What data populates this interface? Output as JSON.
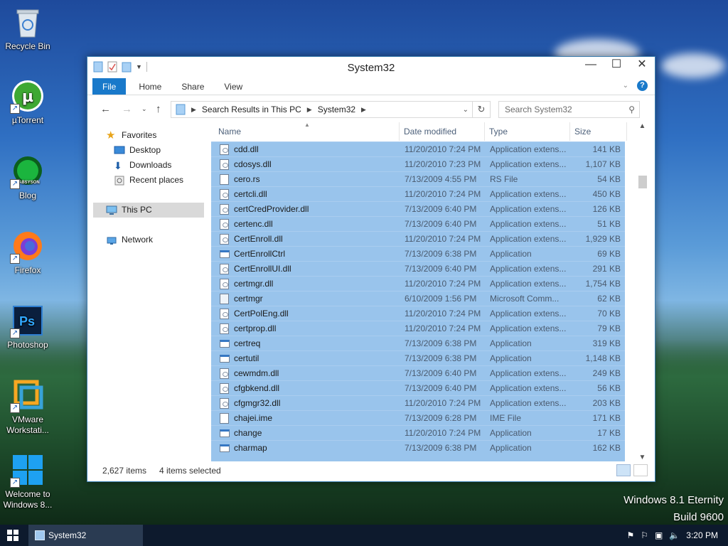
{
  "desktop": {
    "icons": [
      {
        "label": "Recycle Bin"
      },
      {
        "label": "µTorrent"
      },
      {
        "label": "Blog"
      },
      {
        "label": "Firefox"
      },
      {
        "label": "Photoshop"
      },
      {
        "label": "VMware Workstati..."
      },
      {
        "label": "Welcome to Windows 8..."
      }
    ],
    "blog_logo_text": "LABSYSON",
    "watermark_line1": "Windows 8.1 Eternity",
    "watermark_line2": "Build 9600"
  },
  "window": {
    "title": "System32",
    "tabs": {
      "file": "File",
      "home": "Home",
      "share": "Share",
      "view": "View"
    },
    "address": {
      "crumb1": "Search Results in This PC",
      "crumb2": "System32"
    },
    "search_placeholder": "Search System32",
    "nav": {
      "favorites": "Favorites",
      "desktop": "Desktop",
      "downloads": "Downloads",
      "recent": "Recent places",
      "thispc": "This PC",
      "network": "Network"
    },
    "columns": {
      "name": "Name",
      "date": "Date modified",
      "type": "Type",
      "size": "Size"
    },
    "files": [
      {
        "name": "cdd.dll",
        "date": "11/20/2010 7:24 PM",
        "type": "Application extens...",
        "size": "141 KB",
        "icon": "dll"
      },
      {
        "name": "cdosys.dll",
        "date": "11/20/2010 7:23 PM",
        "type": "Application extens...",
        "size": "1,107 KB",
        "icon": "dll"
      },
      {
        "name": "cero.rs",
        "date": "7/13/2009 4:55 PM",
        "type": "RS File",
        "size": "54 KB",
        "icon": "file"
      },
      {
        "name": "certcli.dll",
        "date": "11/20/2010 7:24 PM",
        "type": "Application extens...",
        "size": "450 KB",
        "icon": "dll"
      },
      {
        "name": "certCredProvider.dll",
        "date": "7/13/2009 6:40 PM",
        "type": "Application extens...",
        "size": "126 KB",
        "icon": "dll"
      },
      {
        "name": "certenc.dll",
        "date": "7/13/2009 6:40 PM",
        "type": "Application extens...",
        "size": "51 KB",
        "icon": "dll"
      },
      {
        "name": "CertEnroll.dll",
        "date": "11/20/2010 7:24 PM",
        "type": "Application extens...",
        "size": "1,929 KB",
        "icon": "dll"
      },
      {
        "name": "CertEnrollCtrl",
        "date": "7/13/2009 6:38 PM",
        "type": "Application",
        "size": "69 KB",
        "icon": "app"
      },
      {
        "name": "CertEnrollUI.dll",
        "date": "7/13/2009 6:40 PM",
        "type": "Application extens...",
        "size": "291 KB",
        "icon": "dll"
      },
      {
        "name": "certmgr.dll",
        "date": "11/20/2010 7:24 PM",
        "type": "Application extens...",
        "size": "1,754 KB",
        "icon": "dll"
      },
      {
        "name": "certmgr",
        "date": "6/10/2009 1:56 PM",
        "type": "Microsoft Comm...",
        "size": "62 KB",
        "icon": "msc"
      },
      {
        "name": "CertPolEng.dll",
        "date": "11/20/2010 7:24 PM",
        "type": "Application extens...",
        "size": "70 KB",
        "icon": "dll"
      },
      {
        "name": "certprop.dll",
        "date": "11/20/2010 7:24 PM",
        "type": "Application extens...",
        "size": "79 KB",
        "icon": "dll"
      },
      {
        "name": "certreq",
        "date": "7/13/2009 6:38 PM",
        "type": "Application",
        "size": "319 KB",
        "icon": "app"
      },
      {
        "name": "certutil",
        "date": "7/13/2009 6:38 PM",
        "type": "Application",
        "size": "1,148 KB",
        "icon": "app"
      },
      {
        "name": "cewmdm.dll",
        "date": "7/13/2009 6:40 PM",
        "type": "Application extens...",
        "size": "249 KB",
        "icon": "dll"
      },
      {
        "name": "cfgbkend.dll",
        "date": "7/13/2009 6:40 PM",
        "type": "Application extens...",
        "size": "56 KB",
        "icon": "dll"
      },
      {
        "name": "cfgmgr32.dll",
        "date": "11/20/2010 7:24 PM",
        "type": "Application extens...",
        "size": "203 KB",
        "icon": "dll"
      },
      {
        "name": "chajei.ime",
        "date": "7/13/2009 6:28 PM",
        "type": "IME File",
        "size": "171 KB",
        "icon": "file"
      },
      {
        "name": "change",
        "date": "11/20/2010 7:24 PM",
        "type": "Application",
        "size": "17 KB",
        "icon": "app"
      },
      {
        "name": "charmap",
        "date": "7/13/2009 6:38 PM",
        "type": "Application",
        "size": "162 KB",
        "icon": "app"
      }
    ],
    "status": {
      "count": "2,627 items",
      "selected": "4 items selected"
    }
  },
  "taskbar": {
    "task_label": "System32",
    "clock": "3:20 PM"
  }
}
